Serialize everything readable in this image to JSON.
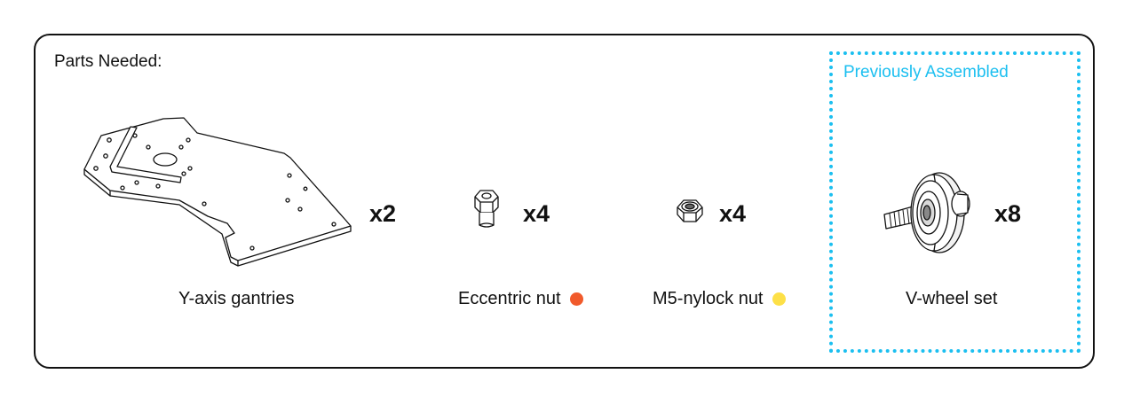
{
  "panel": {
    "title": "Parts Needed:"
  },
  "parts": [
    {
      "label": "Y-axis gantries",
      "quantity": "x2",
      "icon": "y-axis-gantry-plate-icon"
    },
    {
      "label": "Eccentric nut",
      "quantity": "x4",
      "icon": "eccentric-nut-icon",
      "dot_color": "#f15a2b"
    },
    {
      "label": "M5-nylock nut",
      "quantity": "x4",
      "icon": "nylock-nut-icon",
      "dot_color": "#fde047"
    },
    {
      "label": "V-wheel set",
      "quantity": "x8",
      "icon": "v-wheel-set-icon"
    }
  ],
  "assembled_group": {
    "title": "Previously Assembled",
    "color": "#1bbff0"
  }
}
